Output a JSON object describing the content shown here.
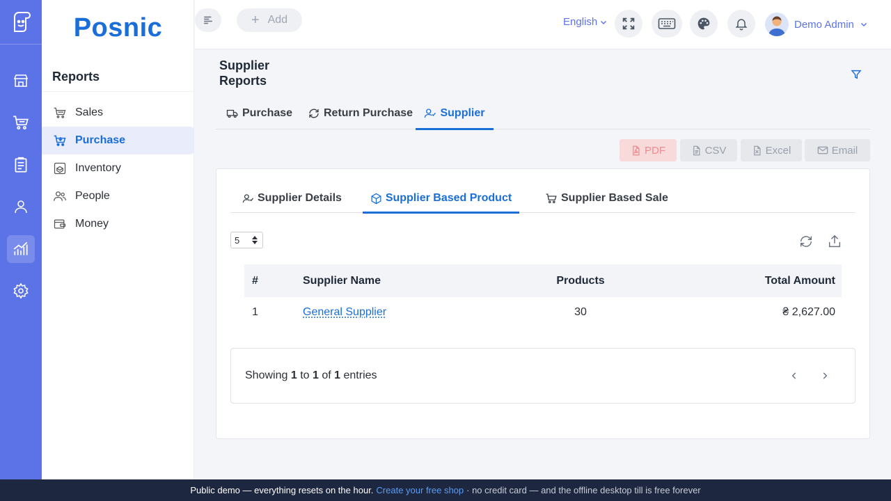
{
  "app": {
    "brand": "Posnic"
  },
  "rail": {
    "items": [
      {
        "name": "store-icon"
      },
      {
        "name": "cart-icon"
      },
      {
        "name": "clipboard-icon"
      },
      {
        "name": "user-icon"
      },
      {
        "name": "chart-icon",
        "active": true
      },
      {
        "name": "settings-icon"
      }
    ]
  },
  "sidebar": {
    "title": "Reports",
    "items": [
      {
        "label": "Sales",
        "icon": "cart-icon"
      },
      {
        "label": "Purchase",
        "icon": "basket-icon",
        "active": true
      },
      {
        "label": "Inventory",
        "icon": "box-icon"
      },
      {
        "label": "People",
        "icon": "people-icon"
      },
      {
        "label": "Money",
        "icon": "money-icon"
      }
    ]
  },
  "topbar": {
    "add_label": "Add",
    "language": "English",
    "user_name": "Demo Admin"
  },
  "page": {
    "title": "Supplier Reports",
    "tabs": [
      {
        "label": "Purchase",
        "icon": "truck-icon"
      },
      {
        "label": "Return Purchase",
        "icon": "refresh-icon"
      },
      {
        "label": "Supplier",
        "icon": "user-check-icon",
        "active": true
      }
    ],
    "export": {
      "pdf": "PDF",
      "csv": "CSV",
      "excel": "Excel",
      "email": "Email"
    }
  },
  "card": {
    "tabs": [
      {
        "label": "Supplier Details",
        "icon": "user-check-icon"
      },
      {
        "label": "Supplier Based Product",
        "icon": "cube-icon",
        "active": true
      },
      {
        "label": "Supplier Based Sale",
        "icon": "cart-icon"
      }
    ],
    "page_size": "5",
    "table": {
      "columns": [
        "#",
        "Supplier Name",
        "Products",
        "Total Amount"
      ],
      "rows": [
        {
          "index": "1",
          "supplier": "General Supplier",
          "products": "30",
          "total": "₴ 2,627.00"
        }
      ]
    },
    "pager": {
      "prefix": "Showing",
      "from": "1",
      "to_word": "to",
      "to": "1",
      "of_word": "of",
      "total": "1",
      "suffix": "entries"
    }
  },
  "banner": {
    "text": "Public demo — everything resets on the hour.",
    "link": "Create your free shop",
    "muted": "· no credit card — and the offline desktop till is free forever"
  },
  "colors": {
    "accent": "#1a6ed8",
    "rail": "#5c73e8",
    "banner": "#1e2740"
  }
}
